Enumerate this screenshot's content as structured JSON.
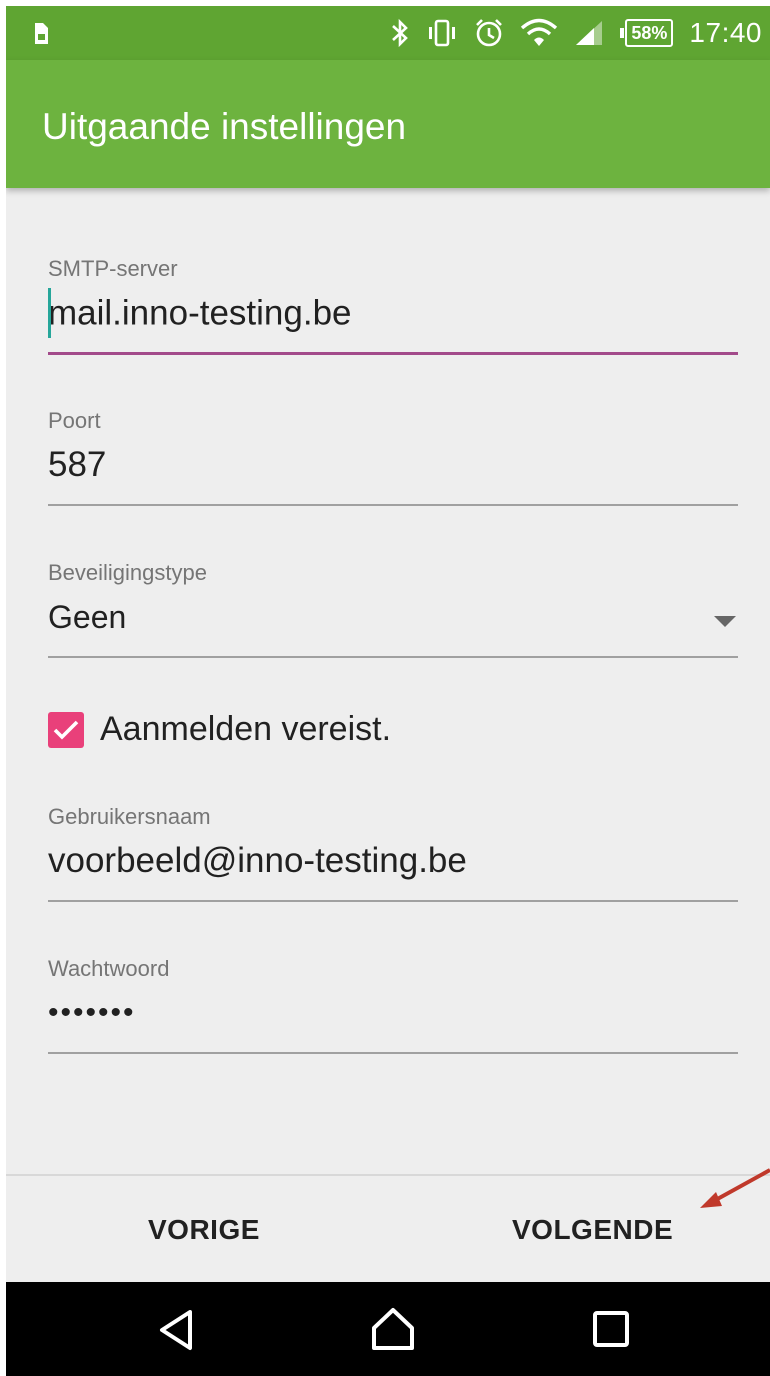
{
  "status_bar": {
    "left_icon": "sim-card-icon",
    "icons": [
      "bluetooth-icon",
      "vibrate-icon",
      "alarm-icon",
      "wifi-icon",
      "cell-signal-icon"
    ],
    "battery": "58%",
    "time": "17:40"
  },
  "app_bar": {
    "title": "Uitgaande instellingen"
  },
  "form": {
    "smtp_server": {
      "label": "SMTP-server",
      "value": "mail.inno-testing.be"
    },
    "port": {
      "label": "Poort",
      "value": "587"
    },
    "security_type": {
      "label": "Beveiligingstype",
      "value": "Geen"
    },
    "login_required": {
      "label": "Aanmelden vereist.",
      "checked": true
    },
    "username": {
      "label": "Gebruikersnaam",
      "value": "voorbeeld@inno-testing.be"
    },
    "password": {
      "label": "Wachtwoord",
      "value": "•••••••"
    }
  },
  "buttons": {
    "previous": "VORIGE",
    "next": "VOLGENDE"
  },
  "nav_bar": {
    "icons": [
      "back-icon",
      "home-icon",
      "recents-icon"
    ]
  },
  "colors": {
    "status_bar": "#5fa532",
    "app_bar": "#6db33f",
    "checkbox": "#e9407a",
    "active_underline": "#a24a8a",
    "cursor": "#26a69a"
  }
}
